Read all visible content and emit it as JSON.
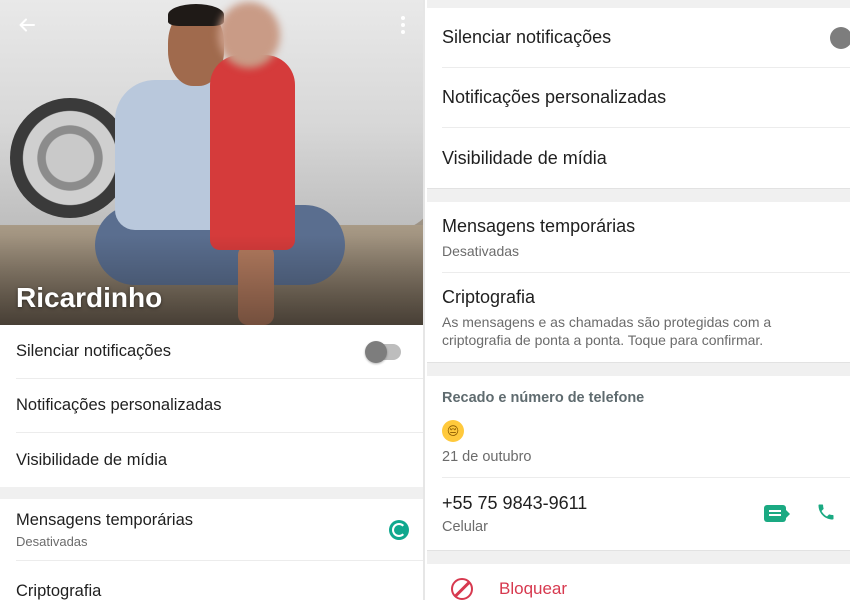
{
  "left_panel": {
    "contact_name": "Ricardinho",
    "back_icon": "arrow-left-icon",
    "menu_icon": "more-vertical-icon",
    "settings": [
      {
        "label": "Silenciar notificações"
      },
      {
        "label": "Notificações personalizadas"
      },
      {
        "label": "Visibilidade de mídia"
      }
    ],
    "temporary_messages": {
      "label": "Mensagens temporárias",
      "status": "Desativadas"
    },
    "encryption": {
      "label": "Criptografia"
    }
  },
  "right_panel": {
    "settings": [
      {
        "label": "Silenciar notificações"
      },
      {
        "label": "Notificações personalizadas"
      },
      {
        "label": "Visibilidade de mídia"
      }
    ],
    "temporary_messages": {
      "label": "Mensagens temporárias",
      "status": "Desativadas"
    },
    "encryption": {
      "label": "Criptografia",
      "description": "As mensagens e as chamadas são protegidas com a criptografia de ponta a ponta. Toque para confirmar."
    },
    "about_section": {
      "header": "Recado e número de telefone",
      "emoji": "😔",
      "date": "21 de outubro"
    },
    "phone": {
      "number": "+55 75 9843-9611",
      "type": "Celular"
    },
    "block": {
      "label": "Bloquear"
    }
  },
  "colors": {
    "accent": "#1aa982",
    "danger": "#d7394f",
    "secondary_text": "#6b6b6b"
  }
}
